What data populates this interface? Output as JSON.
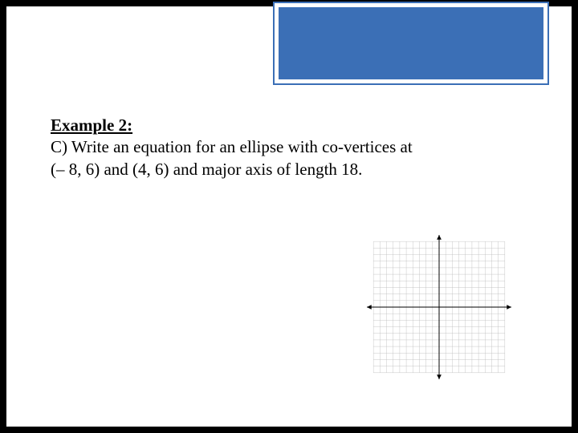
{
  "example": {
    "label": "Example 2:",
    "prompt_line1": "C) Write an equation for an ellipse with co-vertices at",
    "prompt_line2": "(– 8, 6) and (4, 6) and major axis of length 18."
  },
  "graph": {
    "grid_min": -10,
    "grid_max": 10,
    "grid_step": 1
  }
}
